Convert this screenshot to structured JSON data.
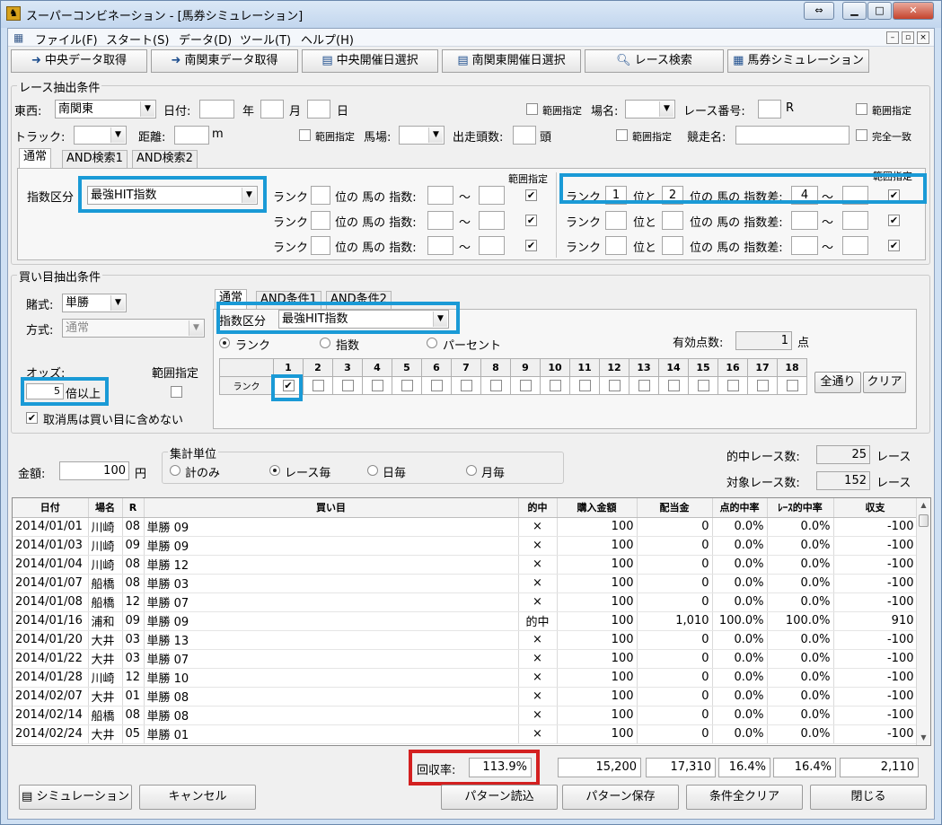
{
  "window": {
    "title": "スーパーコンビネーション - [馬券シミュレーション]",
    "app_icon": "horse-app-icon"
  },
  "menu": [
    "ファイル(F)",
    "スタート(S)",
    "データ(D)",
    "ツール(T)",
    "ヘルプ(H)"
  ],
  "toolbar": [
    {
      "label": "中央データ取得",
      "icon": "arrow-right-icon"
    },
    {
      "label": "南関東データ取得",
      "icon": "arrow-right-icon"
    },
    {
      "label": "中央開催日選択",
      "icon": "calendar-icon"
    },
    {
      "label": "南関東開催日選択",
      "icon": "calendar-icon"
    },
    {
      "label": "レース検索",
      "icon": "magnifier-icon"
    },
    {
      "label": "馬券シミュレーション",
      "icon": "table-icon"
    }
  ],
  "race_cond": {
    "title": "レース抽出条件",
    "east_west_label": "東西:",
    "east_west_value": "南関東",
    "date_label": "日付:",
    "year_label": "年",
    "month_label": "月",
    "day_label": "日",
    "range1_label": "範囲指定",
    "venue_label": "場名:",
    "race_no_label": "レース番号:",
    "race_no_unit": "R",
    "range2_label": "範囲指定",
    "track_label": "トラック:",
    "distance_label": "距離:",
    "distance_unit": "m",
    "range3_label": "範囲指定",
    "baba_label": "馬場:",
    "runners_label": "出走頭数:",
    "runners_unit": "頭",
    "range4_label": "範囲指定",
    "race_name_label": "競走名:",
    "exact_match_label": "完全一致",
    "tabs": [
      "通常",
      "AND検索1",
      "AND検索2"
    ],
    "index_label": "指数区分",
    "index_value": "最強HIT指数",
    "range_header": "範囲指定",
    "rank_label": "ランク",
    "pos_index_label": "位の 馬の 指数:",
    "tilde": "〜",
    "diff_rank_label": "ランク",
    "diff_and_label": "位と",
    "diff_label": "位の 馬の 指数差:",
    "diff_range_header": "範囲指定",
    "diff_rows": [
      {
        "rank_a": "1",
        "rank_b": "2",
        "from": "4",
        "to": "",
        "checked": true
      },
      {
        "rank_a": "",
        "rank_b": "",
        "from": "",
        "to": "",
        "checked": true
      },
      {
        "rank_a": "",
        "rank_b": "",
        "from": "",
        "to": "",
        "checked": true
      }
    ]
  },
  "bet_cond": {
    "title": "買い目抽出条件",
    "bet_type_label": "賭式:",
    "bet_type_value": "単勝",
    "method_label": "方式:",
    "method_value": "通常",
    "odds_label": "オッズ:",
    "odds_value": "5",
    "odds_unit": "倍以上",
    "odds_range_label": "範囲指定",
    "exclude_label": "取消馬は買い目に含めない",
    "tabs": [
      "通常",
      "AND条件1",
      "AND条件2"
    ],
    "index_label": "指数区分",
    "index_value": "最強HIT指数",
    "radio_rank": "ランク",
    "radio_index": "指数",
    "radio_percent": "パーセント",
    "valid_points_label": "有効点数:",
    "valid_points_value": "1",
    "valid_points_unit": "点",
    "rank_row_label": "ランク",
    "rank_columns": [
      "1",
      "2",
      "3",
      "4",
      "5",
      "6",
      "7",
      "8",
      "9",
      "10",
      "11",
      "12",
      "13",
      "14",
      "15",
      "16",
      "17",
      "18"
    ],
    "rank_checked": [
      1
    ],
    "all_button": "全通り",
    "clear_button": "クリア"
  },
  "amount": {
    "label": "金額:",
    "value": "100",
    "unit": "円"
  },
  "aggregate": {
    "title": "集計単位",
    "options": [
      "計のみ",
      "レース毎",
      "日毎",
      "月毎"
    ],
    "selected": "レース毎"
  },
  "summary": {
    "hit_races_label": "的中レース数:",
    "hit_races_value": "25",
    "hit_races_unit": "レース",
    "target_races_label": "対象レース数:",
    "target_races_value": "152",
    "target_races_unit": "レース"
  },
  "table": {
    "columns": [
      "日付",
      "場名",
      "R",
      "買い目",
      "的中",
      "購入金額",
      "配当金",
      "点的中率",
      "ﾚｰｽ的中率",
      "収支"
    ],
    "rows": [
      [
        "2014/01/01",
        "川崎",
        "08",
        "単勝 09",
        "×",
        "100",
        "0",
        "0.0%",
        "0.0%",
        "-100"
      ],
      [
        "2014/01/03",
        "川崎",
        "09",
        "単勝 09",
        "×",
        "100",
        "0",
        "0.0%",
        "0.0%",
        "-100"
      ],
      [
        "2014/01/04",
        "川崎",
        "08",
        "単勝 12",
        "×",
        "100",
        "0",
        "0.0%",
        "0.0%",
        "-100"
      ],
      [
        "2014/01/07",
        "船橋",
        "08",
        "単勝 03",
        "×",
        "100",
        "0",
        "0.0%",
        "0.0%",
        "-100"
      ],
      [
        "2014/01/08",
        "船橋",
        "12",
        "単勝 07",
        "×",
        "100",
        "0",
        "0.0%",
        "0.0%",
        "-100"
      ],
      [
        "2014/01/16",
        "浦和",
        "09",
        "単勝 09",
        "的中",
        "100",
        "1,010",
        "100.0%",
        "100.0%",
        "910"
      ],
      [
        "2014/01/20",
        "大井",
        "03",
        "単勝 13",
        "×",
        "100",
        "0",
        "0.0%",
        "0.0%",
        "-100"
      ],
      [
        "2014/01/22",
        "大井",
        "03",
        "単勝 07",
        "×",
        "100",
        "0",
        "0.0%",
        "0.0%",
        "-100"
      ],
      [
        "2014/01/28",
        "川崎",
        "12",
        "単勝 10",
        "×",
        "100",
        "0",
        "0.0%",
        "0.0%",
        "-100"
      ],
      [
        "2014/02/07",
        "大井",
        "01",
        "単勝 08",
        "×",
        "100",
        "0",
        "0.0%",
        "0.0%",
        "-100"
      ],
      [
        "2014/02/14",
        "船橋",
        "08",
        "単勝 08",
        "×",
        "100",
        "0",
        "0.0%",
        "0.0%",
        "-100"
      ],
      [
        "2014/02/24",
        "大井",
        "05",
        "単勝 01",
        "×",
        "100",
        "0",
        "0.0%",
        "0.0%",
        "-100"
      ]
    ]
  },
  "totals": {
    "recovery_label": "回収率:",
    "recovery_value": "113.9%",
    "purchase": "15,200",
    "payout": "17,310",
    "point_hit": "16.4%",
    "race_hit": "16.4%",
    "balance": "2,110"
  },
  "buttons": {
    "simulation": "シミュレーション",
    "cancel": "キャンセル",
    "load_pattern": "パターン読込",
    "save_pattern": "パターン保存",
    "clear_all": "条件全クリア",
    "close": "閉じる"
  },
  "colors": {
    "highlight_blue": "#1a9ad6",
    "highlight_red": "#d32020"
  }
}
